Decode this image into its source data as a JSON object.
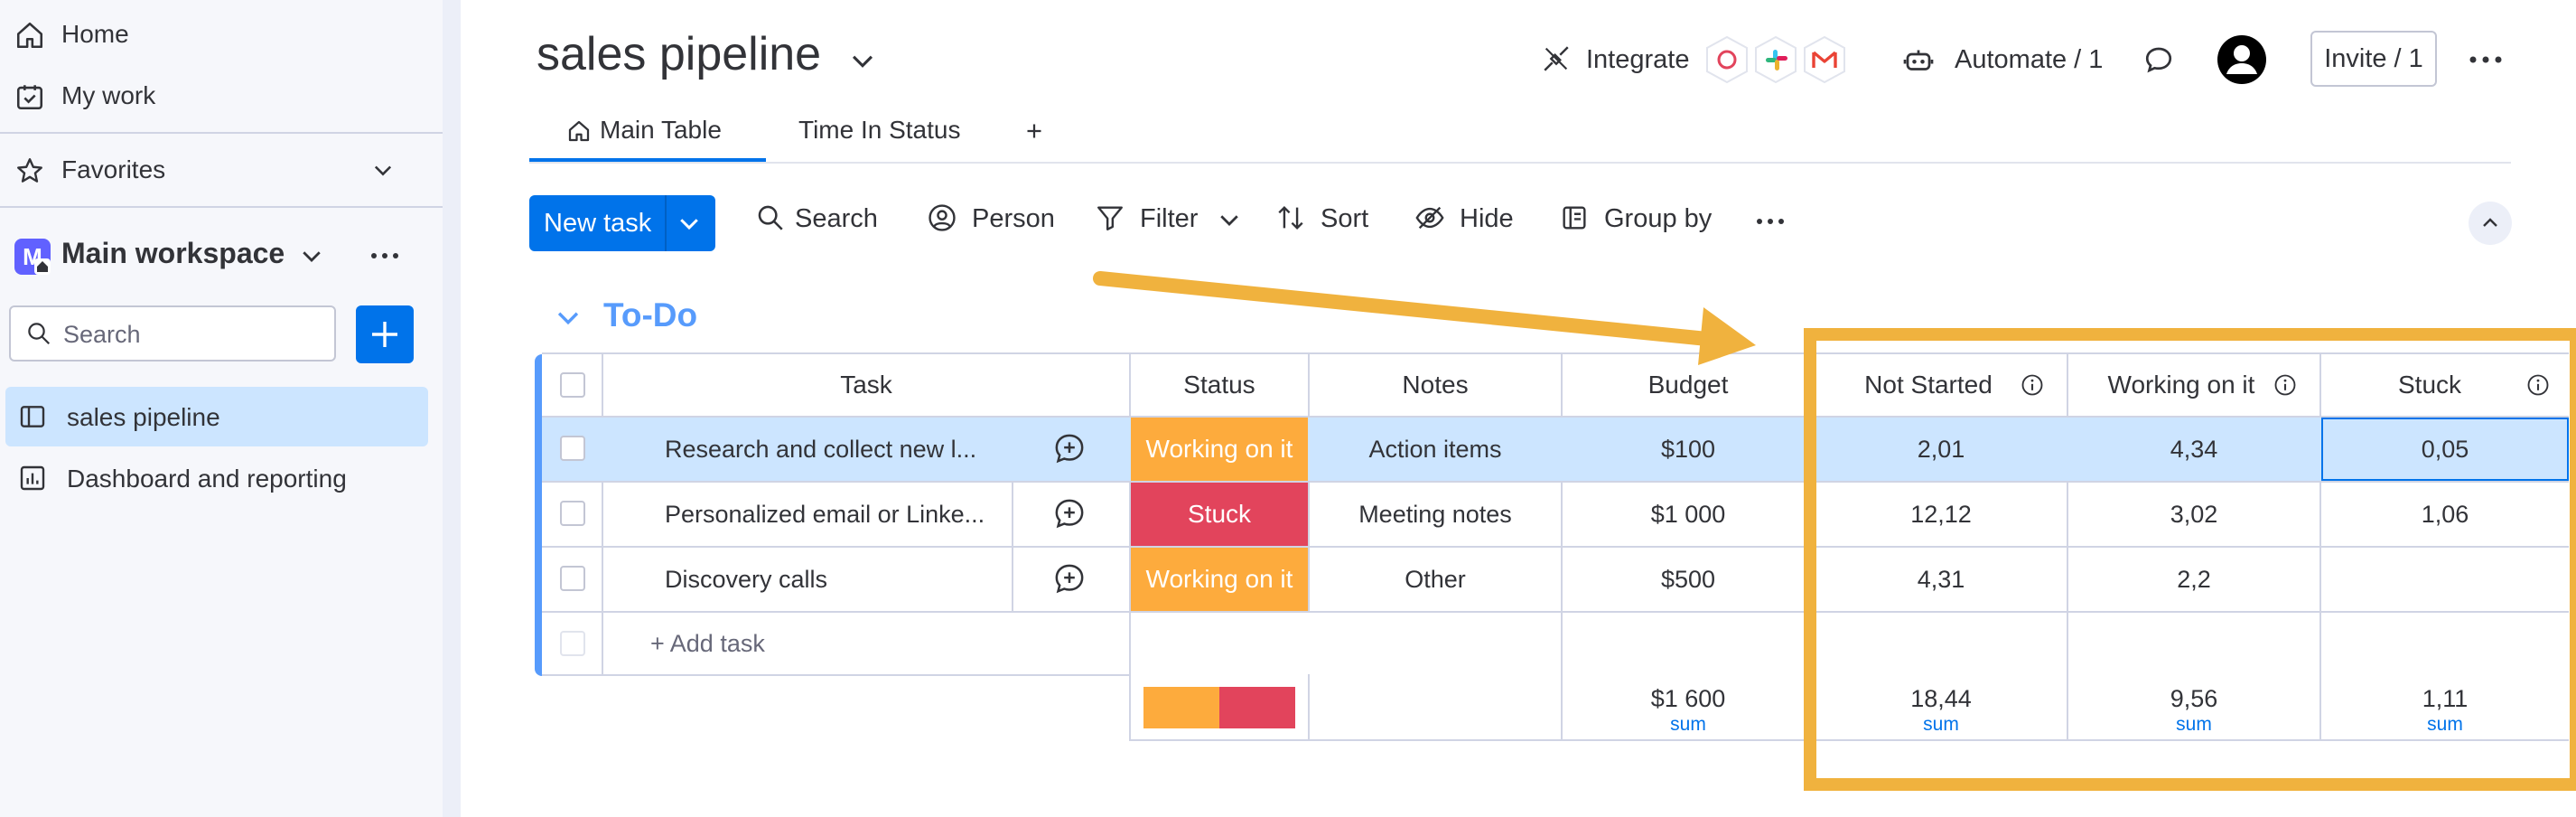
{
  "sidebar": {
    "home_label": "Home",
    "mywork_label": "My work",
    "favorites_label": "Favorites",
    "workspace_initial": "M",
    "workspace_name": "Main workspace",
    "search_placeholder": "Search",
    "boards": [
      {
        "label": "sales pipeline",
        "icon": "board-icon",
        "active": true
      },
      {
        "label": "Dashboard and reporting",
        "icon": "dashboard-icon",
        "active": false
      }
    ]
  },
  "header": {
    "title": "sales pipeline",
    "integrate_label": "Integrate",
    "automate_label": "Automate / 1",
    "invite_label": "Invite / 1"
  },
  "tabs": [
    {
      "label": "Main Table",
      "active": true
    },
    {
      "label": "Time In Status",
      "active": false
    }
  ],
  "toolbar": {
    "new_task_label": "New task",
    "search_label": "Search",
    "person_label": "Person",
    "filter_label": "Filter",
    "sort_label": "Sort",
    "hide_label": "Hide",
    "groupby_label": "Group by"
  },
  "group": {
    "title": "To-Do",
    "color": "#579bfc",
    "columns": {
      "task": "Task",
      "status": "Status",
      "notes": "Notes",
      "budget": "Budget",
      "not_started": "Not Started",
      "working": "Working on it",
      "stuck": "Stuck"
    },
    "rows": [
      {
        "task": "Research and collect new l...",
        "status": "Working on it",
        "status_color": "#fdab3d",
        "notes": "Action items",
        "budget": "$100",
        "not_started": "2,01",
        "working": "4,34",
        "stuck": "0,05"
      },
      {
        "task": "Personalized email or Linke...",
        "status": "Stuck",
        "status_color": "#e2445c",
        "notes": "Meeting notes",
        "budget": "$1 000",
        "not_started": "12,12",
        "working": "3,02",
        "stuck": "1,06"
      },
      {
        "task": "Discovery calls",
        "status": "Working on it",
        "status_color": "#fdab3d",
        "notes": "Other",
        "budget": "$500",
        "not_started": "4,31",
        "working": "2,2",
        "stuck": ""
      }
    ],
    "add_task_label": "+ Add task",
    "summary": {
      "status_distribution": [
        {
          "color": "#fdab3d",
          "fraction": 0.5
        },
        {
          "color": "#e2445c",
          "fraction": 0.5
        }
      ],
      "budget": "$1 600",
      "not_started": "18,44",
      "working": "9,56",
      "stuck": "1,11",
      "sum_label": "sum"
    }
  },
  "annotation_color": "#f0b23e"
}
